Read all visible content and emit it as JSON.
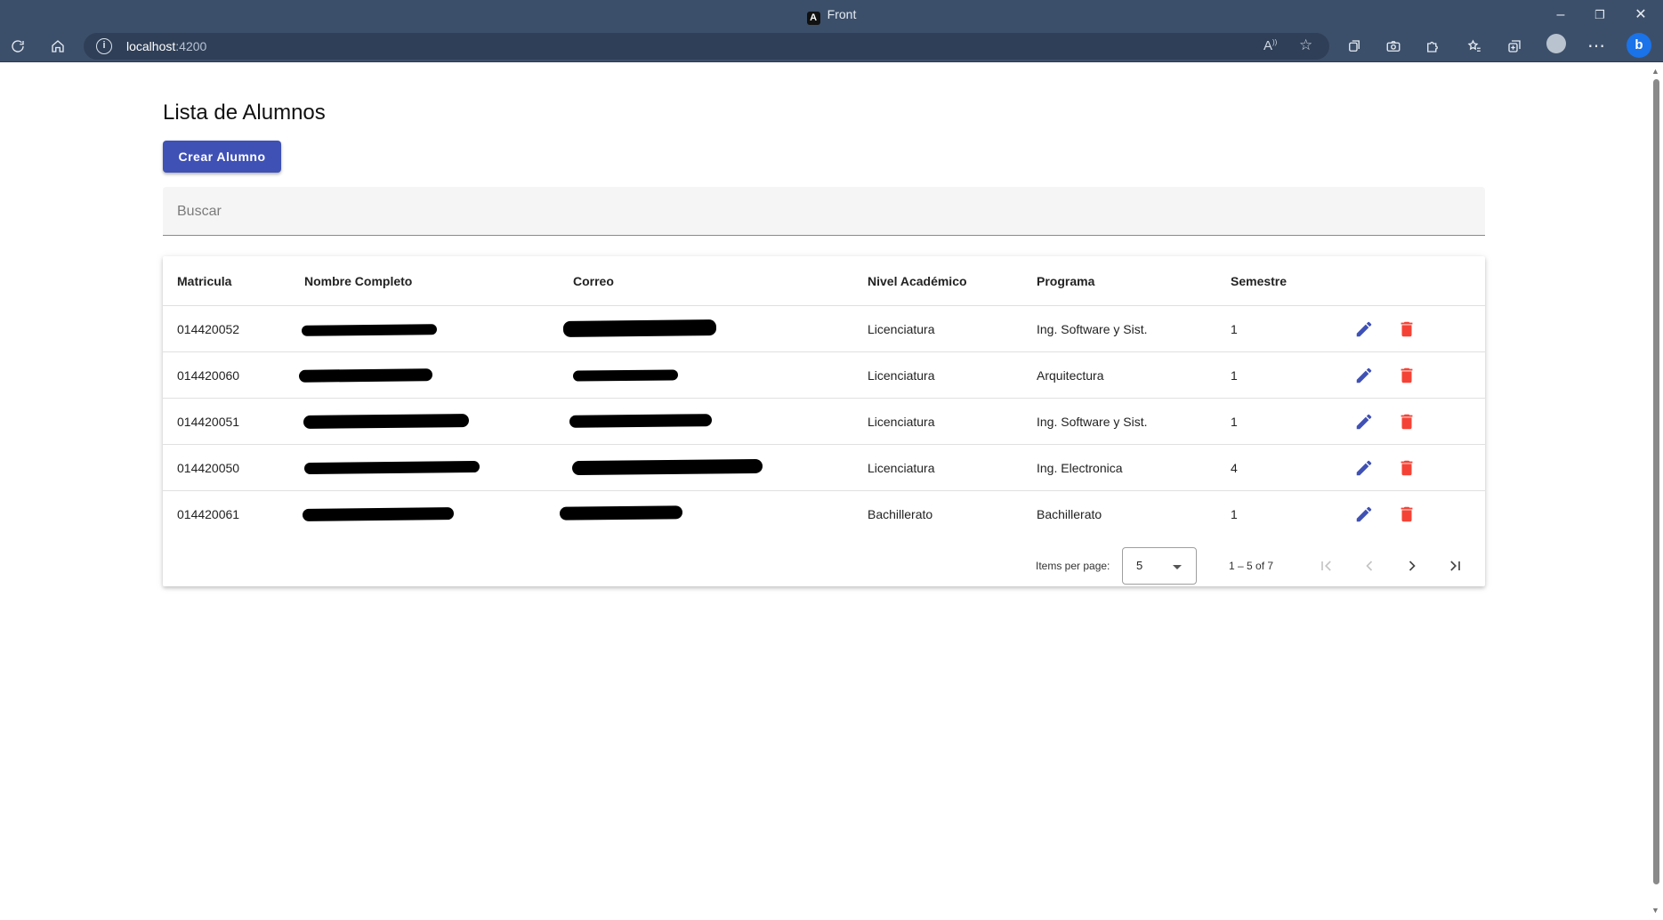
{
  "browser": {
    "tab_title": "Front",
    "url_host": "localhost",
    "url_port": ":4200"
  },
  "page": {
    "title": "Lista de Alumnos",
    "create_button": "Crear Alumno",
    "search_placeholder": "Buscar"
  },
  "table": {
    "headers": {
      "matricula": "Matricula",
      "nombre": "Nombre Completo",
      "correo": "Correo",
      "nivel": "Nivel Académico",
      "programa": "Programa",
      "semestre": "Semestre"
    },
    "rows": [
      {
        "matricula": "014420052",
        "nivel": "Licenciatura",
        "programa": "Ing. Software y Sist.",
        "semestre": "1"
      },
      {
        "matricula": "014420060",
        "nivel": "Licenciatura",
        "programa": "Arquitectura",
        "semestre": "1"
      },
      {
        "matricula": "014420051",
        "nivel": "Licenciatura",
        "programa": "Ing. Software y Sist.",
        "semestre": "1"
      },
      {
        "matricula": "014420050",
        "nivel": "Licenciatura",
        "programa": "Ing. Electronica",
        "semestre": "4"
      },
      {
        "matricula": "014420061",
        "nivel": "Bachillerato",
        "programa": "Bachillerato",
        "semestre": "1"
      }
    ]
  },
  "paginator": {
    "items_per_page_label": "Items per page:",
    "page_size": "5",
    "range_label": "1 – 5 of 7"
  },
  "colors": {
    "primary": "#3f51b5",
    "delete": "#f44336",
    "chrome": "#3c4f6a"
  }
}
